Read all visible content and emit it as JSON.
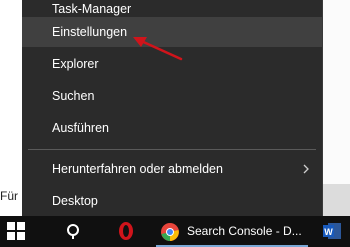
{
  "menu": {
    "items": [
      {
        "label": "Task-Manager"
      },
      {
        "label": "Einstellungen"
      },
      {
        "label": "Explorer"
      },
      {
        "label": "Suchen"
      },
      {
        "label": "Ausführen"
      },
      {
        "label": "Herunterfahren oder abmelden"
      },
      {
        "label": "Desktop"
      }
    ]
  },
  "background": {
    "left_text": "Für"
  },
  "taskbar": {
    "active_window_label": "Search Console - D..."
  },
  "colors": {
    "menu_bg": "#2b2b2b",
    "highlight_bg": "#404040",
    "arrow": "#d0141b",
    "taskbar_bg": "#101010"
  }
}
